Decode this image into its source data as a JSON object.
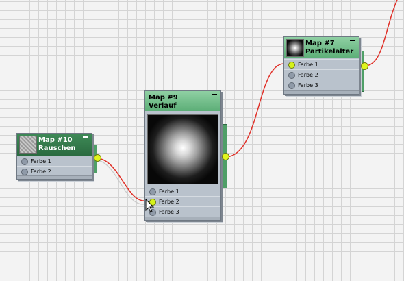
{
  "nodes": {
    "map10": {
      "title": "Map #10",
      "subtitle": "Rauschen",
      "thumbnail": "noise-texture",
      "slots": [
        {
          "label": "Farbe 1",
          "connected": false
        },
        {
          "label": "Farbe 2",
          "connected": false
        }
      ]
    },
    "map9": {
      "title": "Map #9",
      "subtitle": "Verlauf",
      "thumbnail": "radial-gradient-cloud",
      "slots": [
        {
          "label": "Farbe 1",
          "connected": false
        },
        {
          "label": "Farbe 2",
          "connected": true
        },
        {
          "label": "Farbe 3",
          "connected": false
        }
      ]
    },
    "map7": {
      "title": "Map #7",
      "subtitle": "Partikelalter",
      "thumbnail": "particle-cloud",
      "slots": [
        {
          "label": "Farbe 1",
          "connected": true
        },
        {
          "label": "Farbe 2",
          "connected": false
        },
        {
          "label": "Farbe 3",
          "connected": false
        }
      ]
    }
  },
  "connections": [
    {
      "from": "Map #10",
      "to": "Map #9 / Farbe 2"
    },
    {
      "from": "Map #9",
      "to": "Map #7 / Farbe 1"
    },
    {
      "from": "Map #7",
      "to": "off-screen"
    }
  ],
  "colors": {
    "wire": "#e0302a",
    "socket_active": "#d6f21a",
    "header_dark": "#2f7548",
    "header_light": "#7cc493",
    "node_body": "#b9c2cc"
  },
  "icons": [
    "collapse-icon",
    "mouse-pointer-icon"
  ]
}
